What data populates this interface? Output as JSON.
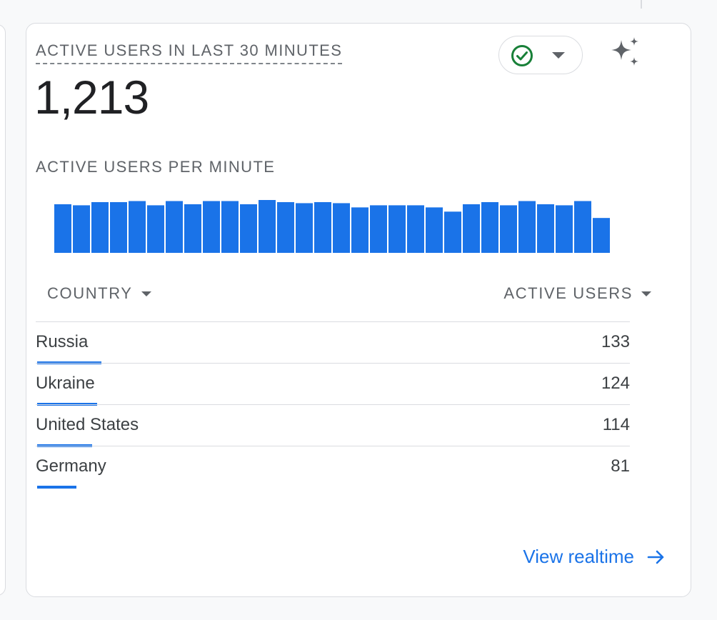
{
  "card": {
    "title": "ACTIVE USERS IN LAST 30 MINUTES",
    "value": "1,213"
  },
  "chart_title": "ACTIVE USERS PER MINUTE",
  "chart_data": {
    "type": "bar",
    "title": "",
    "xlabel": "",
    "ylabel": "",
    "ylim": [
      0,
      50
    ],
    "values": [
      46,
      45,
      48,
      48,
      49,
      45,
      49,
      46,
      49,
      49,
      46,
      50,
      48,
      47,
      48,
      47,
      43,
      45,
      45,
      45,
      43,
      39,
      46,
      48,
      45,
      49,
      46,
      45,
      49,
      33
    ],
    "color": "#1a73e8"
  },
  "table": {
    "country_header": "COUNTRY",
    "users_header": "ACTIVE USERS",
    "rows": [
      {
        "country": "Russia",
        "users": "133",
        "share": 1.0
      },
      {
        "country": "Ukraine",
        "users": "124",
        "share": 0.93
      },
      {
        "country": "United States",
        "users": "114",
        "share": 0.86
      },
      {
        "country": "Germany",
        "users": "81",
        "share": 0.61
      }
    ]
  },
  "link": {
    "label": "View realtime"
  },
  "colors": {
    "accent": "#1a73e8",
    "status_ok": "#188038"
  },
  "icons": {
    "status": "check-circle-icon",
    "insights": "sparkle-icon",
    "link": "arrow-right-icon"
  }
}
